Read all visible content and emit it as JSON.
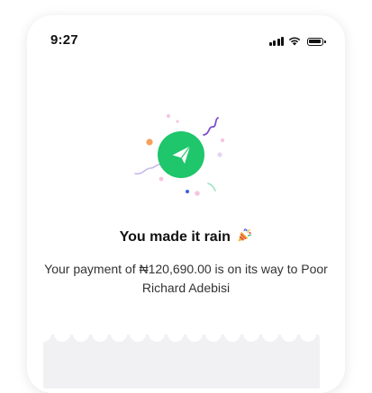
{
  "status_bar": {
    "time": "9:27",
    "icons": [
      "signal-icon",
      "wifi-icon",
      "battery-icon"
    ]
  },
  "illustration": {
    "icon": "send-paper-plane-icon",
    "accent_color": "#1fc66b",
    "confetti_colors": [
      "#f5a05a",
      "#7b4fd0",
      "#f4c5e0",
      "#3d5fd6",
      "#9be3c3"
    ]
  },
  "success": {
    "title": "You made it rain",
    "title_emoji": "party-popper-icon",
    "message": "Your payment of ₦120,690.00 is on its way to Poor Richard Adebisi"
  },
  "colors": {
    "background": "#ffffff",
    "text_primary": "#111111",
    "text_secondary": "#333333",
    "receipt_bg": "#f1f1f3"
  }
}
